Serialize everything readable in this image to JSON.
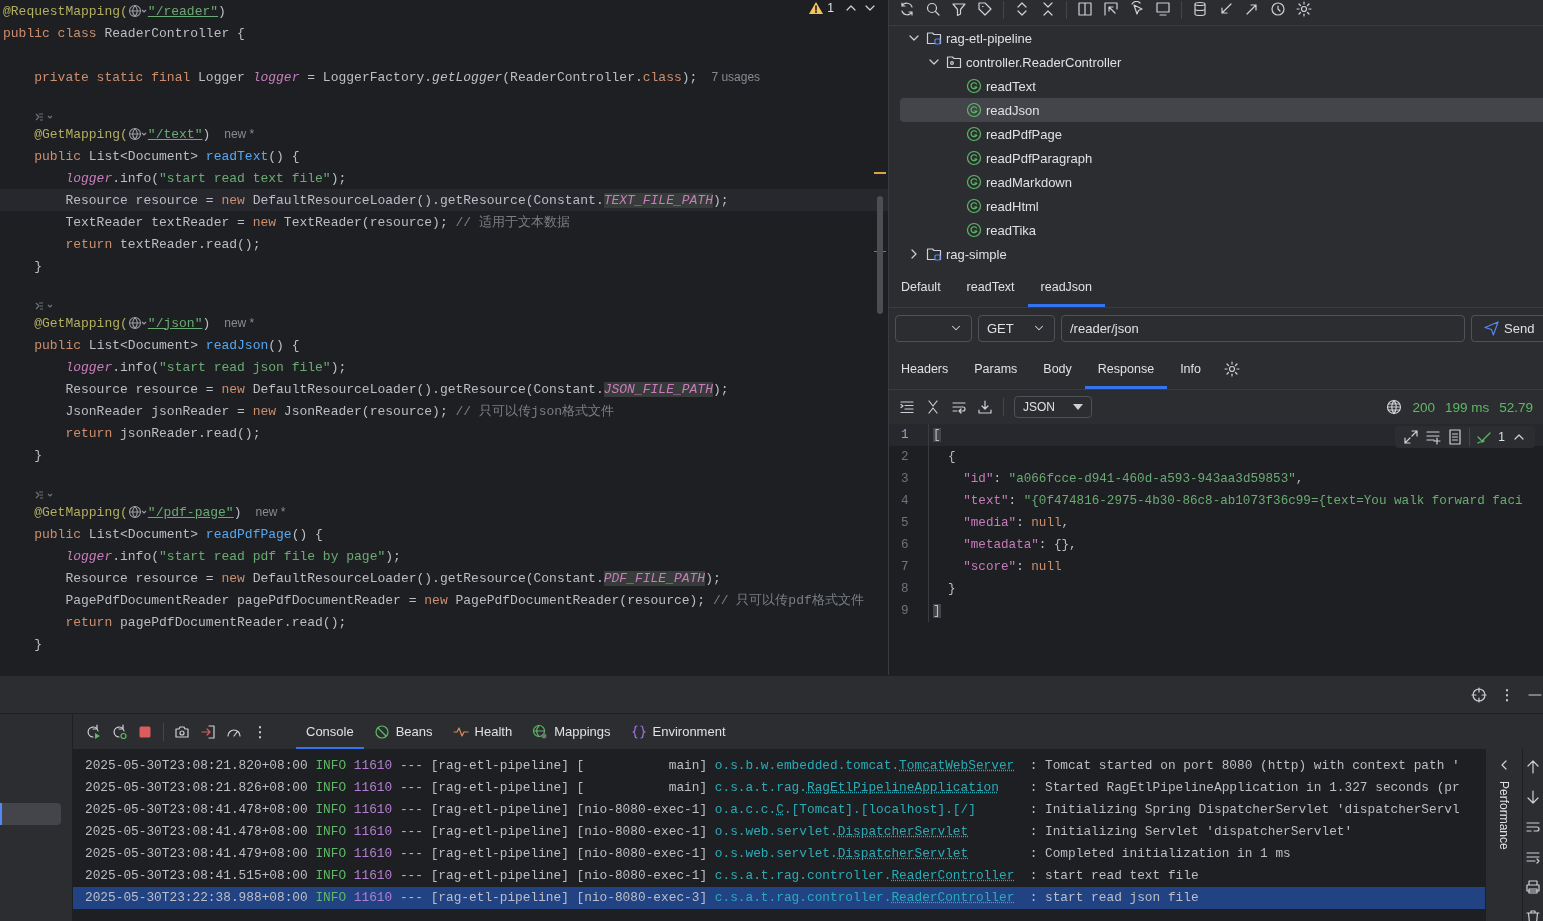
{
  "editor": {
    "warning_count": "1",
    "lines": [
      {
        "kind": "code",
        "current": false,
        "tokens": [
          {
            "text": "@RequestMapping(",
            "kind": "annotation"
          },
          {
            "kind": "globe"
          },
          {
            "text": "\"/reader\"",
            "kind": "url"
          },
          {
            "text": ")",
            "kind": "plain"
          }
        ]
      },
      {
        "kind": "code",
        "current": false,
        "tokens": [
          {
            "text": "public class ",
            "kind": "keyword"
          },
          {
            "text": "ReaderController {",
            "kind": "plain"
          }
        ]
      },
      {
        "kind": "blank",
        "current": false
      },
      {
        "kind": "code",
        "current": false,
        "tokens": [
          {
            "text": "    private static final ",
            "kind": "keyword"
          },
          {
            "text": "Logger ",
            "kind": "plain"
          },
          {
            "text": "logger",
            "kind": "field"
          },
          {
            "text": " = LoggerFactory.",
            "kind": "plain"
          },
          {
            "text": "getLogger",
            "kind": "static_call"
          },
          {
            "text": "(ReaderController.",
            "kind": "plain"
          },
          {
            "text": "class",
            "kind": "keyword"
          },
          {
            "text": ");",
            "kind": "plain"
          },
          {
            "text": "7 usages",
            "kind": "hint"
          }
        ]
      },
      {
        "kind": "blank",
        "current": false
      },
      {
        "kind": "marker",
        "current": false
      },
      {
        "kind": "code",
        "current": false,
        "tokens": [
          {
            "text": "    @GetMapping(",
            "kind": "annotation"
          },
          {
            "kind": "globe"
          },
          {
            "text": "\"/text\"",
            "kind": "url"
          },
          {
            "text": ")",
            "kind": "plain"
          },
          {
            "text": "new *",
            "kind": "hint"
          }
        ]
      },
      {
        "kind": "code",
        "current": false,
        "tokens": [
          {
            "text": "    public ",
            "kind": "keyword"
          },
          {
            "text": "List<Document> ",
            "kind": "plain"
          },
          {
            "text": "readText",
            "kind": "method"
          },
          {
            "text": "() {",
            "kind": "plain"
          }
        ]
      },
      {
        "kind": "code",
        "current": false,
        "tokens": [
          {
            "text": "        logger",
            "kind": "field"
          },
          {
            "text": ".info(",
            "kind": "plain"
          },
          {
            "text": "\"start read text file\"",
            "kind": "string"
          },
          {
            "text": ");",
            "kind": "plain"
          }
        ]
      },
      {
        "kind": "code",
        "current": true,
        "tokens": [
          {
            "text": "        Resource resource = ",
            "kind": "plain"
          },
          {
            "text": "new ",
            "kind": "keyword"
          },
          {
            "text": "DefaultResourceLoader().getResource(Constant.",
            "kind": "plain"
          },
          {
            "text": "TEXT_FILE_PATH",
            "kind": "constant"
          },
          {
            "text": ");",
            "kind": "plain"
          }
        ]
      },
      {
        "kind": "code",
        "current": false,
        "tokens": [
          {
            "text": "        TextReader textReader = ",
            "kind": "plain"
          },
          {
            "text": "new ",
            "kind": "keyword"
          },
          {
            "text": "TextReader(resource); ",
            "kind": "plain"
          },
          {
            "text": "// 适用于文本数据",
            "kind": "comment"
          }
        ]
      },
      {
        "kind": "code",
        "current": false,
        "tokens": [
          {
            "text": "        return ",
            "kind": "keyword"
          },
          {
            "text": "textReader.read();",
            "kind": "plain"
          }
        ]
      },
      {
        "kind": "code",
        "current": false,
        "tokens": [
          {
            "text": "    }",
            "kind": "plain"
          }
        ]
      },
      {
        "kind": "blank",
        "current": false
      },
      {
        "kind": "marker",
        "current": false
      },
      {
        "kind": "code",
        "current": false,
        "tokens": [
          {
            "text": "    @GetMapping(",
            "kind": "annotation"
          },
          {
            "kind": "globe"
          },
          {
            "text": "\"/json\"",
            "kind": "url"
          },
          {
            "text": ")",
            "kind": "plain"
          },
          {
            "text": "new *",
            "kind": "hint"
          }
        ]
      },
      {
        "kind": "code",
        "current": false,
        "tokens": [
          {
            "text": "    public ",
            "kind": "keyword"
          },
          {
            "text": "List<Document> ",
            "kind": "plain"
          },
          {
            "text": "readJson",
            "kind": "method"
          },
          {
            "text": "() {",
            "kind": "plain"
          }
        ]
      },
      {
        "kind": "code",
        "current": false,
        "tokens": [
          {
            "text": "        logger",
            "kind": "field"
          },
          {
            "text": ".info(",
            "kind": "plain"
          },
          {
            "text": "\"start read json file\"",
            "kind": "string"
          },
          {
            "text": ");",
            "kind": "plain"
          }
        ]
      },
      {
        "kind": "code",
        "current": false,
        "tokens": [
          {
            "text": "        Resource resource = ",
            "kind": "plain"
          },
          {
            "text": "new ",
            "kind": "keyword"
          },
          {
            "text": "DefaultResourceLoader().getResource(Constant.",
            "kind": "plain"
          },
          {
            "text": "JSON_FILE_PATH",
            "kind": "constant"
          },
          {
            "text": ");",
            "kind": "plain"
          }
        ]
      },
      {
        "kind": "code",
        "current": false,
        "tokens": [
          {
            "text": "        JsonReader jsonReader = ",
            "kind": "plain"
          },
          {
            "text": "new ",
            "kind": "keyword"
          },
          {
            "text": "JsonReader(resource); ",
            "kind": "plain"
          },
          {
            "text": "// 只可以传json格式文件",
            "kind": "comment"
          }
        ]
      },
      {
        "kind": "code",
        "current": false,
        "tokens": [
          {
            "text": "        return ",
            "kind": "keyword"
          },
          {
            "text": "jsonReader.read();",
            "kind": "plain"
          }
        ]
      },
      {
        "kind": "code",
        "current": false,
        "tokens": [
          {
            "text": "    }",
            "kind": "plain"
          }
        ]
      },
      {
        "kind": "blank",
        "current": false
      },
      {
        "kind": "marker",
        "current": false
      },
      {
        "kind": "code",
        "current": false,
        "tokens": [
          {
            "text": "    @GetMapping(",
            "kind": "annotation"
          },
          {
            "kind": "globe"
          },
          {
            "text": "\"/pdf-page\"",
            "kind": "url"
          },
          {
            "text": ")",
            "kind": "plain"
          },
          {
            "text": "new *",
            "kind": "hint"
          }
        ]
      },
      {
        "kind": "code",
        "current": false,
        "tokens": [
          {
            "text": "    public ",
            "kind": "keyword"
          },
          {
            "text": "List<Document> ",
            "kind": "plain"
          },
          {
            "text": "readPdfPage",
            "kind": "method"
          },
          {
            "text": "() {",
            "kind": "plain"
          }
        ]
      },
      {
        "kind": "code",
        "current": false,
        "tokens": [
          {
            "text": "        logger",
            "kind": "field"
          },
          {
            "text": ".info(",
            "kind": "plain"
          },
          {
            "text": "\"start read pdf file by page\"",
            "kind": "string"
          },
          {
            "text": ");",
            "kind": "plain"
          }
        ]
      },
      {
        "kind": "code",
        "current": false,
        "tokens": [
          {
            "text": "        Resource resource = ",
            "kind": "plain"
          },
          {
            "text": "new ",
            "kind": "keyword"
          },
          {
            "text": "DefaultResourceLoader().getResource(Constant.",
            "kind": "plain"
          },
          {
            "text": "PDF_FILE_PATH",
            "kind": "constant"
          },
          {
            "text": ");",
            "kind": "plain"
          }
        ]
      },
      {
        "kind": "code",
        "current": false,
        "tokens": [
          {
            "text": "        PagePdfDocumentReader pagePdfDocumentReader = ",
            "kind": "plain"
          },
          {
            "text": "new ",
            "kind": "keyword"
          },
          {
            "text": "PagePdfDocumentReader(resource); ",
            "kind": "plain"
          },
          {
            "text": "// 只可以传pdf格式文件",
            "kind": "comment"
          }
        ]
      },
      {
        "kind": "code",
        "current": false,
        "tokens": [
          {
            "text": "        return ",
            "kind": "keyword"
          },
          {
            "text": "pagePdfDocumentReader.read();",
            "kind": "plain"
          }
        ]
      },
      {
        "kind": "code",
        "current": false,
        "tokens": [
          {
            "text": "    }",
            "kind": "plain"
          }
        ]
      }
    ]
  },
  "endpoints": {
    "tree": [
      {
        "label": "rag-etl-pipeline",
        "kind": "module",
        "expanded": true,
        "selected": false,
        "children": [
          {
            "label": "controller.ReaderController",
            "kind": "class",
            "expanded": true,
            "selected": false,
            "children": [
              {
                "label": "readText",
                "kind": "endpoint",
                "selected": false
              },
              {
                "label": "readJson",
                "kind": "endpoint",
                "selected": true
              },
              {
                "label": "readPdfPage",
                "kind": "endpoint",
                "selected": false
              },
              {
                "label": "readPdfParagraph",
                "kind": "endpoint",
                "selected": false
              },
              {
                "label": "readMarkdown",
                "kind": "endpoint",
                "selected": false
              },
              {
                "label": "readHtml",
                "kind": "endpoint",
                "selected": false
              },
              {
                "label": "readTika",
                "kind": "endpoint",
                "selected": false
              }
            ]
          }
        ]
      },
      {
        "label": "rag-simple",
        "kind": "module",
        "expanded": false,
        "selected": false
      }
    ],
    "request_tabs": [
      {
        "label": "Default",
        "selected": false
      },
      {
        "label": "readText",
        "selected": false
      },
      {
        "label": "readJson",
        "selected": true
      }
    ],
    "request": {
      "method": "GET",
      "url": "/reader/json",
      "send": "Send"
    },
    "detail_tabs": [
      {
        "label": "Headers",
        "selected": false
      },
      {
        "label": "Params",
        "selected": false
      },
      {
        "label": "Body",
        "selected": false
      },
      {
        "label": "Response",
        "selected": true
      },
      {
        "label": "Info",
        "selected": false
      }
    ],
    "format": "JSON",
    "status": {
      "code": "200",
      "time": "199 ms",
      "size": "52.79"
    },
    "inspection_count": "1",
    "response_lines": [
      {
        "number": "1",
        "current": true,
        "tokens": [
          {
            "text": "[",
            "kind": "bracket"
          }
        ]
      },
      {
        "number": "2",
        "current": false,
        "tokens": [
          {
            "text": "  {",
            "kind": "plain"
          }
        ]
      },
      {
        "number": "3",
        "current": false,
        "tokens": [
          {
            "text": "    \"id\"",
            "kind": "key"
          },
          {
            "text": ": ",
            "kind": "plain"
          },
          {
            "text": "\"a066fcce-d941-460d-a593-943aa3d59853\"",
            "kind": "string"
          },
          {
            "text": ",",
            "kind": "plain"
          }
        ]
      },
      {
        "number": "4",
        "current": false,
        "tokens": [
          {
            "text": "    \"text\"",
            "kind": "key"
          },
          {
            "text": ": ",
            "kind": "plain"
          },
          {
            "text": "\"{0f474816-2975-4b30-86c8-ab1073f36c99={text=You walk forward faci",
            "kind": "string"
          }
        ]
      },
      {
        "number": "5",
        "current": false,
        "tokens": [
          {
            "text": "    \"media\"",
            "kind": "key"
          },
          {
            "text": ": ",
            "kind": "plain"
          },
          {
            "text": "null",
            "kind": "null"
          },
          {
            "text": ",",
            "kind": "plain"
          }
        ]
      },
      {
        "number": "6",
        "current": false,
        "tokens": [
          {
            "text": "    \"metadata\"",
            "kind": "key"
          },
          {
            "text": ": {},",
            "kind": "plain"
          }
        ]
      },
      {
        "number": "7",
        "current": false,
        "tokens": [
          {
            "text": "    \"score\"",
            "kind": "key"
          },
          {
            "text": ": ",
            "kind": "plain"
          },
          {
            "text": "null",
            "kind": "null"
          }
        ]
      },
      {
        "number": "8",
        "current": false,
        "tokens": [
          {
            "text": "  }",
            "kind": "plain"
          }
        ]
      },
      {
        "number": "9",
        "current": false,
        "tokens": [
          {
            "text": "]",
            "kind": "bracket"
          }
        ]
      }
    ]
  },
  "run_panel": {
    "tabs": [
      {
        "label": "Console",
        "selected": true
      },
      {
        "label": "Beans",
        "selected": false
      },
      {
        "label": "Health",
        "selected": false
      },
      {
        "label": "Mappings",
        "selected": false
      },
      {
        "label": "Environment",
        "selected": false
      }
    ],
    "side_tab": "Performance",
    "log": [
      {
        "time": "2025-05-30T23:08:21.820+08:00",
        "level": "INFO",
        "pid": "11610",
        "sep": "---",
        "app": "[rag-etl-pipeline]",
        "thread": "[           main]",
        "logger": [
          {
            "text": "o.s.b.w.embedded.tomcat.",
            "underlined": false
          },
          {
            "text": "TomcatWebServer",
            "underlined": true
          }
        ],
        "message": ": Tomcat started on port 8080 (http) with context path '",
        "selected": false
      },
      {
        "time": "2025-05-30T23:08:21.826+08:00",
        "level": "INFO",
        "pid": "11610",
        "sep": "---",
        "app": "[rag-etl-pipeline]",
        "thread": "[           main]",
        "logger": [
          {
            "text": "c.s.a.t.rag.",
            "underlined": false
          },
          {
            "text": "RagEtlPipelineApplication",
            "underlined": true
          }
        ],
        "message": ": Started RagEtlPipelineApplication in 1.327 seconds (pr",
        "selected": false
      },
      {
        "time": "2025-05-30T23:08:41.478+08:00",
        "level": "INFO",
        "pid": "11610",
        "sep": "---",
        "app": "[rag-etl-pipeline]",
        "thread": "[nio-8080-exec-1]",
        "logger": [
          {
            "text": "o.a.c.c.",
            "underlined": false
          },
          {
            "text": "C",
            "underlined": true
          },
          {
            "text": ".[Tomcat].[localhost].[/]",
            "underlined": false
          }
        ],
        "message": ": Initializing Spring DispatcherServlet 'dispatcherServl",
        "selected": false
      },
      {
        "time": "2025-05-30T23:08:41.478+08:00",
        "level": "INFO",
        "pid": "11610",
        "sep": "---",
        "app": "[rag-etl-pipeline]",
        "thread": "[nio-8080-exec-1]",
        "logger": [
          {
            "text": "o.s.web.servlet.",
            "underlined": false
          },
          {
            "text": "DispatcherServlet",
            "underlined": true
          }
        ],
        "message": ": Initializing Servlet 'dispatcherServlet'",
        "selected": false
      },
      {
        "time": "2025-05-30T23:08:41.479+08:00",
        "level": "INFO",
        "pid": "11610",
        "sep": "---",
        "app": "[rag-etl-pipeline]",
        "thread": "[nio-8080-exec-1]",
        "logger": [
          {
            "text": "o.s.web.servlet.",
            "underlined": false
          },
          {
            "text": "DispatcherServlet",
            "underlined": true
          }
        ],
        "message": ": Completed initialization in 1 ms",
        "selected": false
      },
      {
        "time": "2025-05-30T23:08:41.515+08:00",
        "level": "INFO",
        "pid": "11610",
        "sep": "---",
        "app": "[rag-etl-pipeline]",
        "thread": "[nio-8080-exec-1]",
        "logger": [
          {
            "text": "c.s.a.t.rag.controller.",
            "underlined": false
          },
          {
            "text": "ReaderController",
            "underlined": true
          }
        ],
        "message": ": start read text file",
        "selected": false
      },
      {
        "time": "2025-05-30T23:22:38.988+08:00",
        "level": "INFO",
        "pid": "11610",
        "sep": "---",
        "app": "[rag-etl-pipeline]",
        "thread": "[nio-8080-exec-3]",
        "logger": [
          {
            "text": "c.s.a.t.rag.controller.",
            "underlined": false
          },
          {
            "text": "ReaderController",
            "underlined": true
          }
        ],
        "message": ": start read json file",
        "selected": true
      }
    ]
  }
}
